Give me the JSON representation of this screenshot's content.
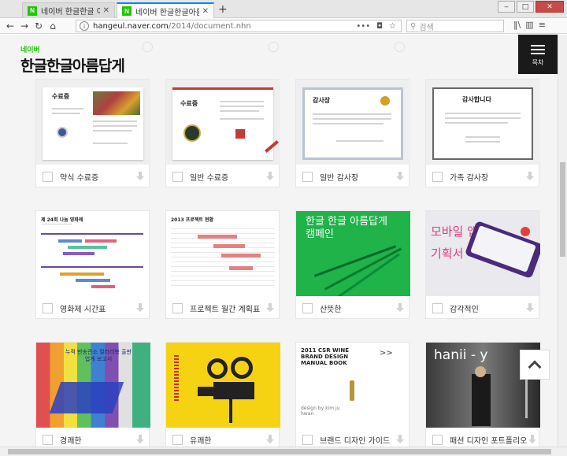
{
  "browser": {
    "tabs": [
      {
        "title": "네이버 한글한글 아름답게 : 네"
      },
      {
        "title": "네이버 한글한글아름답게"
      }
    ],
    "url_host": "hangeul.naver.com",
    "url_path": "/2014/document.nhn",
    "search_placeholder": "검색"
  },
  "site": {
    "naver": "네이버",
    "brand": "한글한글아름답게",
    "toc_label": "목차"
  },
  "cards": [
    {
      "label": "약식 수료증",
      "thumb": {
        "title": "수료증"
      }
    },
    {
      "label": "일반 수료증",
      "thumb": {
        "title": "수료증"
      }
    },
    {
      "label": "일반 감사장",
      "thumb": {
        "title": "감사장"
      }
    },
    {
      "label": "가족 감사장",
      "thumb": {
        "title": "감사합니다"
      }
    },
    {
      "label": "영화제 시간표",
      "thumb": {
        "title": "제 24회 나눔 영화제"
      }
    },
    {
      "label": "프로젝트 월간 계획표",
      "thumb": {
        "title": "2013 프로젝트 현황"
      }
    },
    {
      "label": "산뜻한",
      "thumb": {
        "title": "한글 한글 아름답게 캠페인"
      }
    },
    {
      "label": "감각적인",
      "thumb": {
        "title": "모바일 앱 기획서"
      }
    },
    {
      "label": "경쾌한",
      "thumb": {
        "title": "누적 반송관소 컬러리북 출판업계 보고서"
      }
    },
    {
      "label": "유쾌한",
      "thumb": {
        "title": ""
      }
    },
    {
      "label": "브랜드 디자인 가이드",
      "thumb": {
        "title": "2011 CSR WINE BRAND DESIGN MANUAL BOOK",
        "sub": "design by kim ju hwan"
      }
    },
    {
      "label": "패션 디자인 포트폴리오",
      "thumb": {
        "title": "hanii - y"
      }
    }
  ]
}
